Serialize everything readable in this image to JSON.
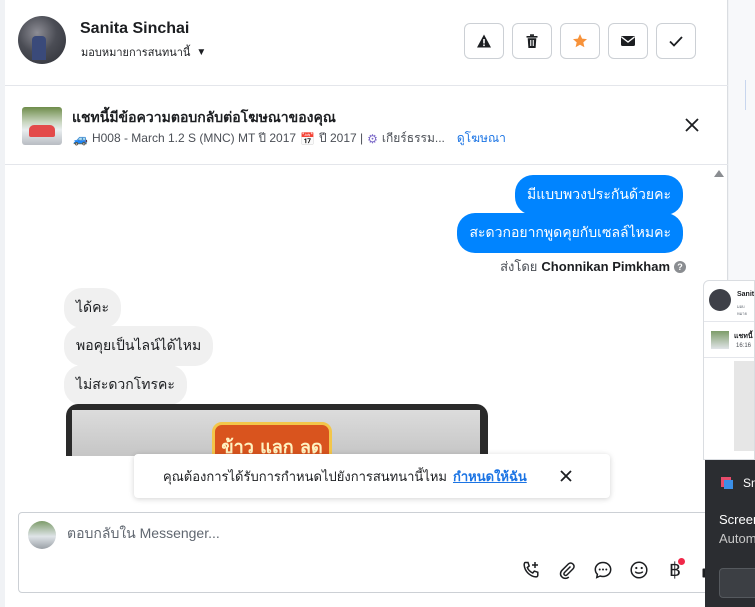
{
  "header": {
    "contact_name": "Sanita Sinchai",
    "assign_label": "มอบหมายการสนทนานี้",
    "actions": [
      {
        "name": "report",
        "icon": "warning-icon"
      },
      {
        "name": "delete",
        "icon": "trash-icon"
      },
      {
        "name": "star",
        "icon": "star-icon",
        "color": "#f7923a"
      },
      {
        "name": "email",
        "icon": "envelope-icon"
      },
      {
        "name": "done",
        "icon": "check-icon"
      }
    ]
  },
  "ad": {
    "title": "แชทนี้มีข้อความตอบกลับต่อโฆษณาของคุณ",
    "car_label": "H008 - March 1.2 S (MNC) MT ปี 2017",
    "year_label": "ปี 2017 |",
    "gear_label": "เกียร์ธรรม...",
    "link": "ดูโฆษณา"
  },
  "thread": {
    "outgoing": [
      "มีแบบพวงประกันด้วยคะ",
      "สะดวกอยากพูดคุยกับเซลล์ไหมคะ"
    ],
    "sent_by_prefix": "ส่งโดย",
    "sent_by_name": "Chonnikan Pimkham",
    "incoming": [
      "ได้คะ",
      "พอคุยเป็นไลน์ได้ไหม",
      "ไม่สะดวกโทรคะ"
    ],
    "image_sign_text": "ข้าว แลก ลด"
  },
  "toast": {
    "text": "คุณต้องการได้รับการกำหนดไปยังการสนทนานี้ไหม",
    "link": "กำหนดให้ฉัน"
  },
  "composer": {
    "placeholder": "ตอบกลับใน Messenger..."
  },
  "mini_window": {
    "name": "Sanit",
    "sub": "มอบหมาย",
    "ad": "แชทนี้",
    "time": "16:16"
  },
  "popup": {
    "title": "Sn",
    "line1": "Screen",
    "line2": "Autom"
  },
  "colors": {
    "accent": "#0084ff",
    "link": "#1b74e4",
    "star": "#f7923a"
  }
}
